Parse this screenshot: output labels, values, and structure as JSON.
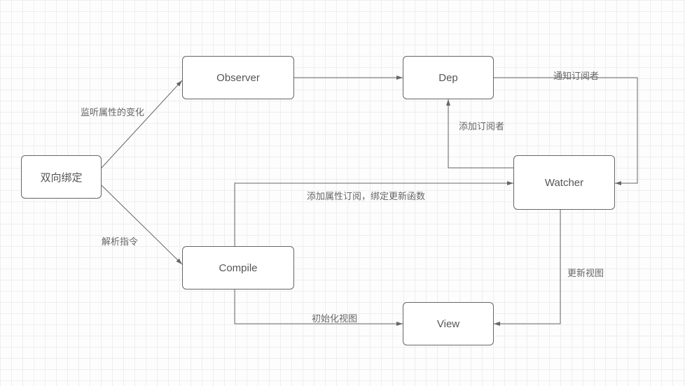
{
  "nodes": {
    "binding": {
      "label": "双向绑定"
    },
    "observer": {
      "label": "Observer"
    },
    "compile": {
      "label": "Compile"
    },
    "dep": {
      "label": "Dep"
    },
    "watcher": {
      "label": "Watcher"
    },
    "view": {
      "label": "View"
    }
  },
  "edges": {
    "binding_observer": {
      "label": "监听属性的变化"
    },
    "binding_compile": {
      "label": "解析指令"
    },
    "observer_dep": {
      "label": ""
    },
    "compile_watcher": {
      "label": "添加属性订阅，绑定更新函数"
    },
    "compile_view": {
      "label": "初始化视图"
    },
    "watcher_dep": {
      "label": "添加订阅者"
    },
    "dep_watcher": {
      "label": "通知订阅者"
    },
    "watcher_view": {
      "label": "更新视图"
    }
  },
  "diagram_type": "flowchart"
}
